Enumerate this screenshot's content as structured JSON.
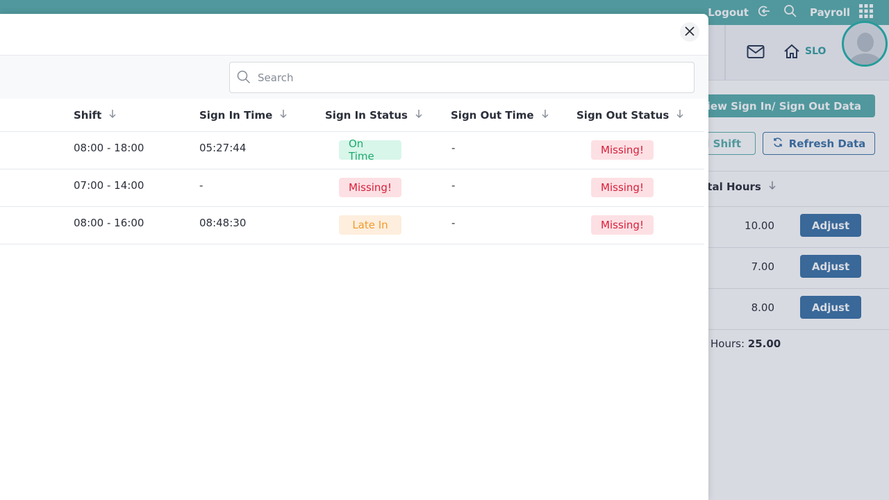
{
  "topbar": {
    "logout_label": "Logout",
    "payroll_label": "Payroll",
    "icons": [
      "logout-icon",
      "search-icon",
      "apps-grid-icon"
    ]
  },
  "background": {
    "location_label": "SLO",
    "view_button": "View Sign In/ Sign Out Data",
    "add_shift_button": "d Shift",
    "refresh_button": "Refresh Data",
    "total_hours_header": "otal Hours",
    "rows": [
      {
        "hours": "10.00",
        "action": "Adjust"
      },
      {
        "hours": "7.00",
        "action": "Adjust"
      },
      {
        "hours": "8.00",
        "action": "Adjust"
      }
    ],
    "total_label": "Hours:",
    "total_value": "25.00"
  },
  "modal": {
    "search_placeholder": "Search",
    "columns": [
      "Shift",
      "Sign In Time",
      "Sign In Status",
      "Sign Out Time",
      "Sign Out Status"
    ],
    "rows": [
      {
        "shift": "08:00 - 18:00",
        "sign_in_time": "05:27:44",
        "sign_in_status": "On Time",
        "sign_out_time": "-",
        "sign_out_status": "Missing!"
      },
      {
        "shift": "07:00 - 14:00",
        "sign_in_time": "-",
        "sign_in_status": "Missing!",
        "sign_out_time": "-",
        "sign_out_status": "Missing!"
      },
      {
        "shift": "08:00 - 16:00",
        "sign_in_time": "08:48:30",
        "sign_in_status": "Late In",
        "sign_out_time": "-",
        "sign_out_status": "Missing!"
      }
    ]
  },
  "colors": {
    "teal": "#5aafad",
    "blue": "#3e74a8",
    "ontime": "#1daa6f",
    "missing": "#d81f3a",
    "late": "#f09a2b"
  }
}
